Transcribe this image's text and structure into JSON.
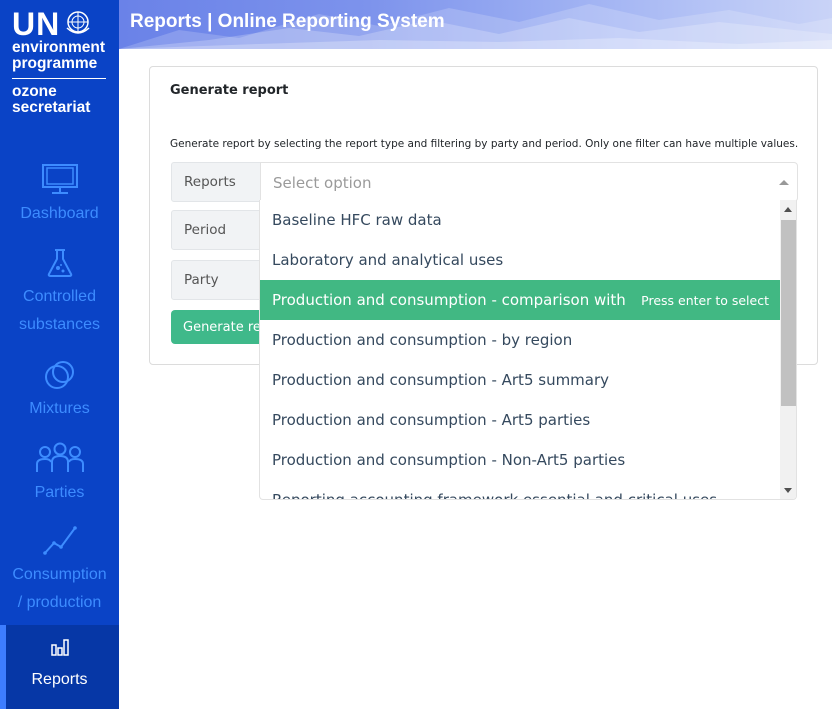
{
  "sidebar": {
    "logo": {
      "un": "UN",
      "line1": "environment",
      "line2": "programme",
      "line3": "ozone",
      "line4": "secretariat"
    },
    "items": [
      {
        "label": "Dashboard",
        "icon": "monitor-icon",
        "active": false
      },
      {
        "label_line1": "Controlled",
        "label_line2": "substances",
        "icon": "flask-icon",
        "active": false
      },
      {
        "label": "Mixtures",
        "icon": "mixtures-icon",
        "active": false
      },
      {
        "label": "Parties",
        "icon": "people-icon",
        "active": false
      },
      {
        "label_line1": "Consumption",
        "label_line2": "/ production",
        "icon": "line-chart-icon",
        "active": false
      },
      {
        "label": "Reports",
        "icon": "bar-chart-icon",
        "active": true
      }
    ]
  },
  "header": {
    "title": "Reports | Online Reporting System"
  },
  "card": {
    "title": "Generate report",
    "description": "Generate report by selecting the report type and filtering by party and period. Only one filter can have multiple values.",
    "fields": {
      "reports_label": "Reports",
      "period_label": "Period",
      "party_label": "Party"
    },
    "reports_select": {
      "placeholder": "Select option"
    },
    "generate_button": "Generate report"
  },
  "dropdown": {
    "options": [
      "Baseline HFC raw data",
      "Laboratory and analytical uses",
      "Production and consumption - comparison with baselines",
      "Production and consumption - by region",
      "Production and consumption - Art5 summary",
      "Production and consumption - Art5 parties",
      "Production and consumption - Non-Art5 parties",
      "Reporting accounting framework essential and critical uses"
    ],
    "highlighted_index": 2,
    "select_hint": "Press enter to select"
  },
  "colors": {
    "sidebar_bg": "#0a43c6",
    "sidebar_text": "#3d8cff",
    "active_bg": "#0637a6",
    "accent_green": "#41b883"
  }
}
